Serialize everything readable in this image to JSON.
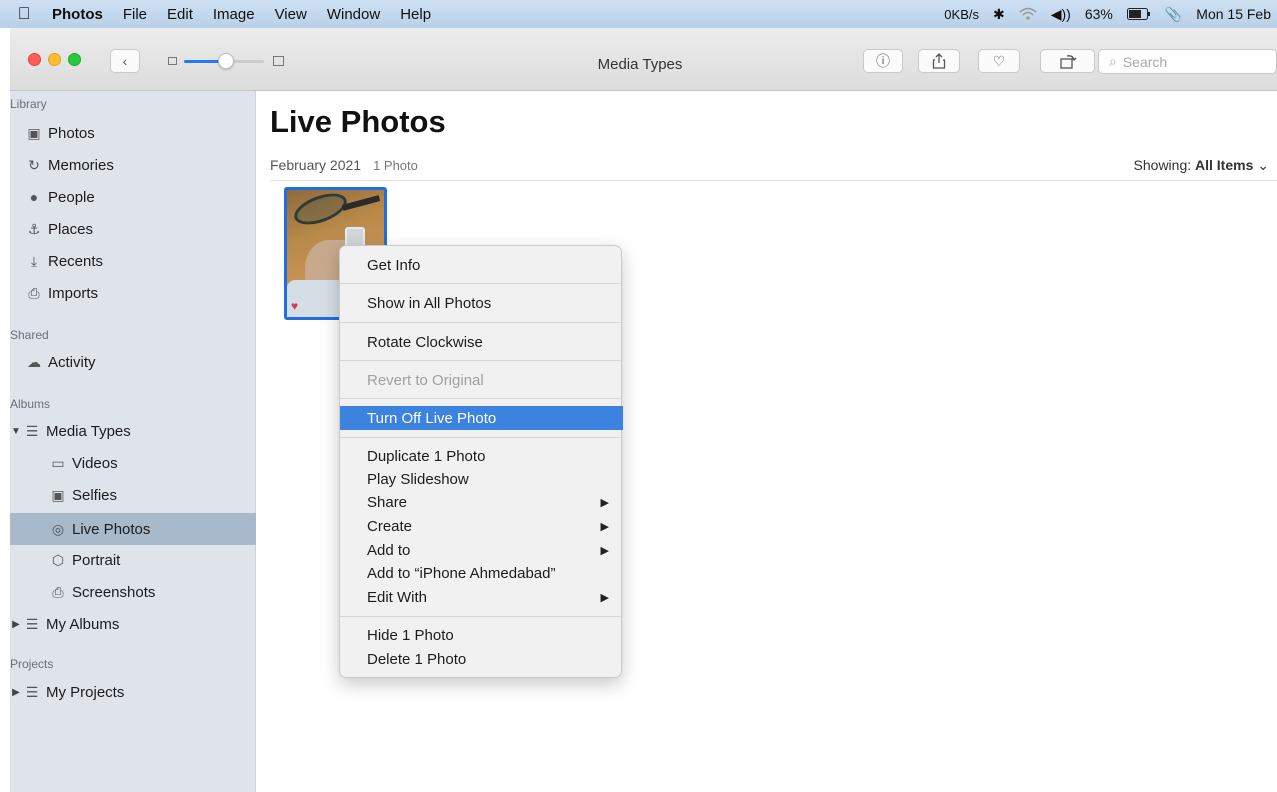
{
  "menubar": {
    "app": "Photos",
    "items": [
      "File",
      "Edit",
      "Image",
      "View",
      "Window",
      "Help"
    ],
    "net": "0KB/s",
    "battery": "63%",
    "clock": "Mon 15 Feb"
  },
  "toolbar": {
    "title": "Media Types",
    "search_placeholder": "Search"
  },
  "sidebar": {
    "library_label": "Library",
    "library": [
      "Photos",
      "Memories",
      "People",
      "Places",
      "Recents",
      "Imports"
    ],
    "shared_label": "Shared",
    "shared": [
      "Activity"
    ],
    "albums_label": "Albums",
    "media_types": "Media Types",
    "media_children": [
      "Videos",
      "Selfies",
      "Live Photos",
      "Portrait",
      "Screenshots"
    ],
    "my_albums": "My Albums",
    "projects_label": "Projects",
    "my_projects": "My Projects"
  },
  "main": {
    "title": "Live Photos",
    "month": "February 2021",
    "count": "1 Photo",
    "showing_label": "Showing:",
    "showing_value": "All Items"
  },
  "context_menu": {
    "items": [
      "Get Info",
      "Show in All Photos",
      "Rotate Clockwise",
      "Revert to Original",
      "Turn Off Live Photo",
      "Duplicate 1 Photo",
      "Play Slideshow",
      "Share",
      "Create",
      "Add to",
      "Add to “iPhone Ahmedabad”",
      "Edit With",
      "Hide 1 Photo",
      "Delete 1 Photo"
    ]
  },
  "colors": {
    "selection": "#a9b9cc",
    "highlight": "#3b83de",
    "accent": "#1f6fe0"
  }
}
